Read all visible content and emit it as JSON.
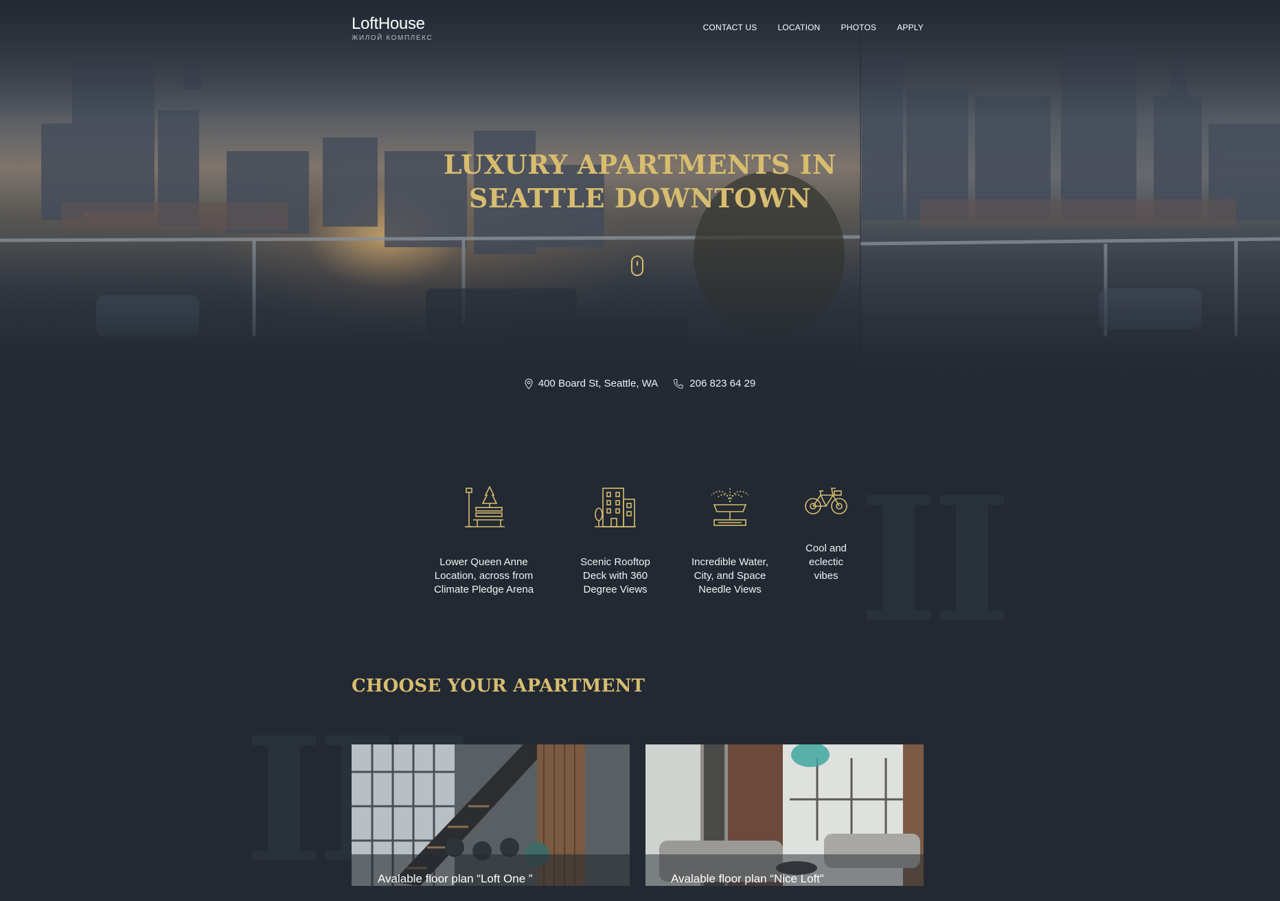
{
  "brand": {
    "name": "LoftHouse",
    "subtitle": "ЖИЛОЙ КОМПЛЕКС"
  },
  "nav": {
    "items": [
      "CONTACT US",
      "LOCATION",
      "PHOTOS",
      "APPLY"
    ]
  },
  "hero": {
    "title_line1": "LUXURY APARTMENTS IN",
    "title_line2": "SEATTLE DOWNTOWN",
    "address": "400 Board St, Seattle, WA",
    "phone": "206 823 64 29"
  },
  "features": [
    {
      "icon": "park-bench-icon",
      "text": "Lower Queen Anne Location, across from Climate Pledge Arena"
    },
    {
      "icon": "building-icon",
      "text": "Scenic Rooftop Deck with 360 Degree Views"
    },
    {
      "icon": "fountain-icon",
      "text": "Incredible Water, City, and Space Needle Views"
    },
    {
      "icon": "bicycle-icon",
      "text": "Cool and eclectic vibes"
    }
  ],
  "decor": {
    "ghost_numeral_features": "II",
    "ghost_numeral_apartments": "III"
  },
  "apartments": {
    "title": "CHOOSE YOUR APARTMENT",
    "cards": [
      {
        "label": "Avalable floor plan “Loft One ”"
      },
      {
        "label": "Avalable floor plan “Nice Loft”"
      }
    ]
  },
  "colors": {
    "background": "#222933",
    "accent_gold": "#d8bd6f",
    "text": "#f2f2f2"
  }
}
